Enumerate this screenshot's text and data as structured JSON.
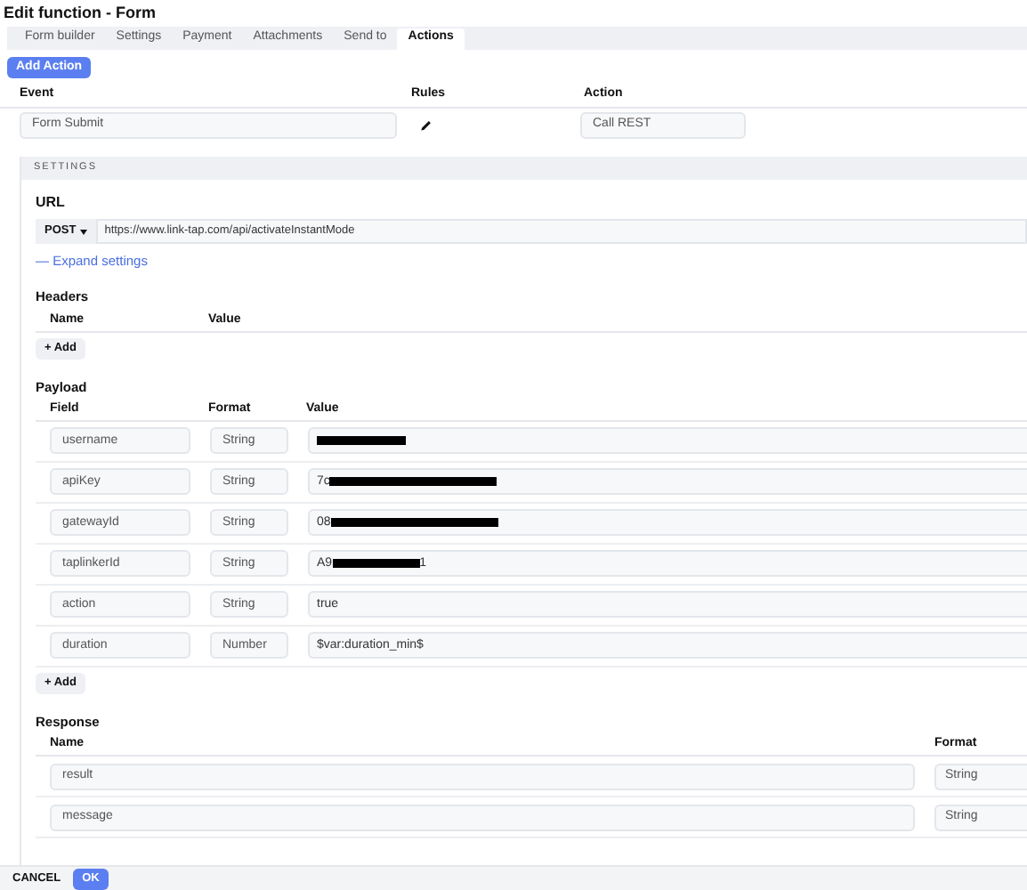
{
  "window": {
    "title": "Edit function - Form"
  },
  "tabs": [
    {
      "label": "Form builder",
      "selected": false
    },
    {
      "label": "Settings",
      "selected": false
    },
    {
      "label": "Payment",
      "selected": false
    },
    {
      "label": "Attachments",
      "selected": false
    },
    {
      "label": "Send to",
      "selected": false
    },
    {
      "label": "Actions",
      "selected": true
    }
  ],
  "add_action_button": "Add Action",
  "actions_table": {
    "columns": [
      "Event",
      "Rules",
      "Action"
    ],
    "rows": [
      {
        "event": "Form Submit",
        "action": "Call REST"
      }
    ]
  },
  "settings": {
    "heading": "SETTINGS",
    "url": {
      "label": "URL",
      "method": "POST",
      "value": "https://www.link-tap.com/api/activateInstantMode",
      "expand_link": "— Expand settings"
    },
    "headers": {
      "heading": "Headers",
      "columns": [
        "Name",
        "Value"
      ],
      "add_button": "+ Add"
    },
    "payload": {
      "heading": "Payload",
      "columns": [
        "Field",
        "Format",
        "Value"
      ],
      "rows": [
        {
          "field": "username",
          "format": "String",
          "redacted": true
        },
        {
          "field": "apiKey",
          "format": "String",
          "value": "7c",
          "redacted": true
        },
        {
          "field": "gatewayId",
          "format": "String",
          "value": "08",
          "redacted": true
        },
        {
          "field": "taplinkerId",
          "format": "String",
          "value": "A9",
          "redacted": true,
          "value_end": "1"
        },
        {
          "field": "action",
          "format": "String",
          "value": "true",
          "redacted": false
        },
        {
          "field": "duration",
          "format": "Number",
          "value": "$var:duration_min$",
          "redacted": false
        }
      ],
      "add_button": "+ Add"
    },
    "response": {
      "heading": "Response",
      "columns": [
        "Name",
        "Format"
      ],
      "rows": [
        {
          "name": "result",
          "format": "String"
        },
        {
          "name": "message",
          "format": "String"
        }
      ]
    }
  },
  "footer": {
    "cancel": "CANCEL",
    "ok": "OK"
  }
}
